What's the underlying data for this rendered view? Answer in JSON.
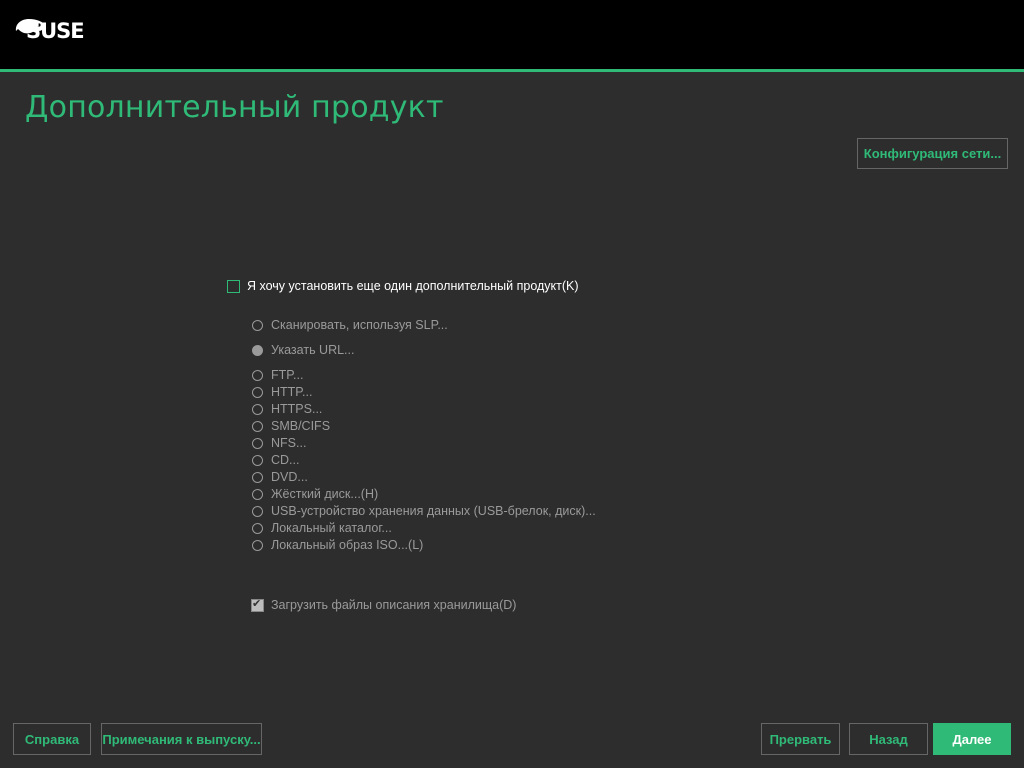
{
  "brand": {
    "logo_text": "SUSE"
  },
  "colors": {
    "accent": "#30ba78",
    "background": "#2d2d2d",
    "topbar": "#000000",
    "disabled_text": "#9a9a9a"
  },
  "page": {
    "title": "Дополнительный продукт"
  },
  "network_button": "Конфигурация сети...",
  "main_checkbox": {
    "label": "Я хочу установить еще один дополнительный продукт(K)",
    "checked": false
  },
  "options": [
    {
      "label": "Сканировать, используя SLP...",
      "selected": false
    },
    {
      "label": "Указать URL...",
      "selected": true
    },
    {
      "label": "FTP...",
      "selected": false
    },
    {
      "label": "HTTP...",
      "selected": false
    },
    {
      "label": "HTTPS...",
      "selected": false
    },
    {
      "label": "SMB/CIFS",
      "selected": false
    },
    {
      "label": "NFS...",
      "selected": false
    },
    {
      "label": "CD...",
      "selected": false
    },
    {
      "label": "DVD...",
      "selected": false
    },
    {
      "label": "Жёсткий диск...(H)",
      "selected": false
    },
    {
      "label": "USB-устройство хранения данных (USB-брелок, диск)...",
      "selected": false
    },
    {
      "label": "Локальный каталог...",
      "selected": false
    },
    {
      "label": "Локальный образ ISO...(L)",
      "selected": false
    }
  ],
  "download_checkbox": {
    "label": "Загрузить файлы описания хранилища(D)",
    "checked": true
  },
  "footer": {
    "help": "Справка",
    "release_notes": "Примечания к выпуску...",
    "abort": "Прервать",
    "back": "Назад",
    "next": "Далее"
  }
}
